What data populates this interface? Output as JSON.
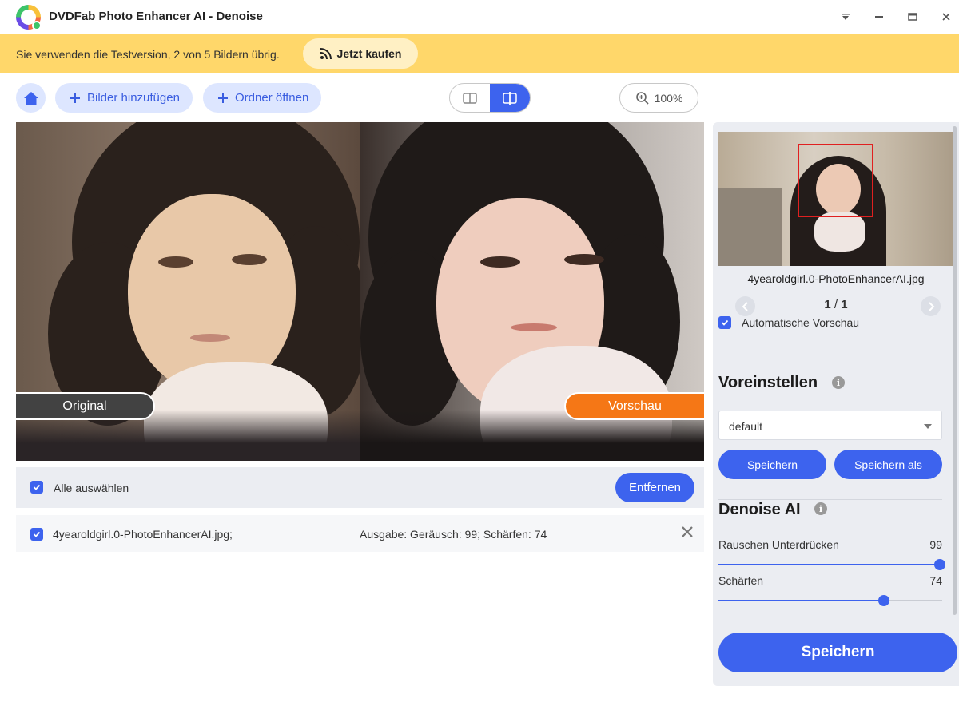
{
  "app": {
    "title": "DVDFab Photo Enhancer AI - Denoise"
  },
  "window_controls": [
    "menu-dropdown-icon",
    "minimize-icon",
    "maximize-icon",
    "close-icon"
  ],
  "banner": {
    "text": "Sie verwenden die Testversion, 2 von 5 Bildern übrig.",
    "buy_label": "Jetzt kaufen",
    "background": "#ffd76a"
  },
  "toolbar": {
    "add_images_label": "Bilder hinzufügen",
    "open_folder_label": "Ordner öffnen",
    "zoom_label": "100%"
  },
  "compare": {
    "original_label": "Original",
    "preview_label": "Vorschau"
  },
  "file_list": {
    "select_all_label": "Alle auswählen",
    "remove_label": "Entfernen",
    "rows": [
      {
        "name": "4yearoldgirl.0-PhotoEnhancerAI.jpg;",
        "output": "Ausgabe: Geräusch: 99; Schärfen: 74"
      }
    ]
  },
  "side": {
    "thumb_name": "4yearoldgirl.0-PhotoEnhancerAI.jpg",
    "page_current": "1",
    "page_total": "1",
    "page_sep": "/",
    "auto_preview_label": "Automatische Vorschau",
    "presets_title": "Voreinstellen",
    "preset_value": "default",
    "save_label": "Speichern",
    "save_as_label": "Speichern als",
    "denoise_title": "Denoise AI",
    "sliders": [
      {
        "label": "Rauschen Unterdrücken",
        "value": "99",
        "fraction": 0.99
      },
      {
        "label": "Schärfen",
        "value": "74",
        "fraction": 0.74
      }
    ],
    "save_big_label": "Speichern"
  },
  "colors": {
    "accent": "#3d63ee",
    "preview_tag": "#f57716",
    "original_tag": "#424242"
  }
}
